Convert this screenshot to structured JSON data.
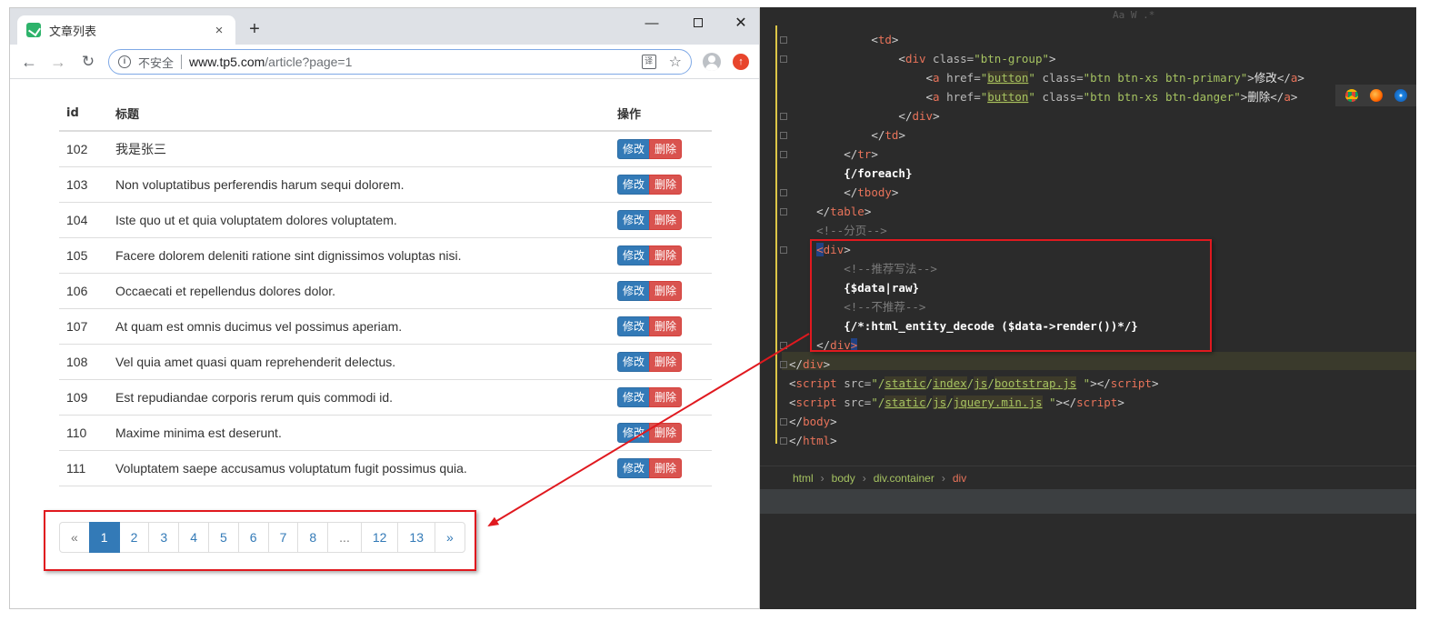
{
  "browser": {
    "tab_title": "文章列表",
    "tab_close": "×",
    "new_tab": "+",
    "window_min": "—",
    "window_close": "✕",
    "nav_back": "←",
    "nav_forward": "→",
    "nav_reload": "↻",
    "security_label": "不安全",
    "url_host": "www.tp5.com",
    "url_path": "/article?page=1",
    "translate_glyph": "译",
    "star_glyph": "☆",
    "update_glyph": "↑"
  },
  "table": {
    "headers": {
      "id": "id",
      "title": "标题",
      "ops": "操作"
    },
    "edit_label": "修改",
    "delete_label": "删除",
    "rows": [
      {
        "id": "102",
        "title": "我是张三"
      },
      {
        "id": "103",
        "title": "Non voluptatibus perferendis harum sequi dolorem."
      },
      {
        "id": "104",
        "title": "Iste quo ut et quia voluptatem dolores voluptatem."
      },
      {
        "id": "105",
        "title": "Facere dolorem deleniti ratione sint dignissimos voluptas nisi."
      },
      {
        "id": "106",
        "title": "Occaecati et repellendus dolores dolor."
      },
      {
        "id": "107",
        "title": "At quam est omnis ducimus vel possimus aperiam."
      },
      {
        "id": "108",
        "title": "Vel quia amet quasi quam reprehenderit delectus."
      },
      {
        "id": "109",
        "title": "Est repudiandae corporis rerum quis commodi id."
      },
      {
        "id": "110",
        "title": "Maxime minima est deserunt."
      },
      {
        "id": "111",
        "title": "Voluptatem saepe accusamus voluptatum fugit possimus quia."
      }
    ]
  },
  "pagination": {
    "prev": "«",
    "pages": [
      "1",
      "2",
      "3",
      "4",
      "5",
      "6",
      "7",
      "8",
      "...",
      "12",
      "13"
    ],
    "next": "»",
    "active": "1"
  },
  "ide": {
    "toolbar_hint": "Aa  W  .*",
    "code_lines": [
      {
        "parts": [
          [
            "i",
            "            "
          ],
          [
            "p",
            "<"
          ],
          [
            "t",
            "td"
          ],
          [
            "p",
            ">"
          ]
        ]
      },
      {
        "parts": [
          [
            "i",
            "                "
          ],
          [
            "p",
            "<"
          ],
          [
            "t",
            "div"
          ],
          [
            "a",
            " class="
          ],
          [
            "v",
            "\"btn-group\""
          ],
          [
            "p",
            ">"
          ]
        ]
      },
      {
        "parts": [
          [
            "i",
            "                    "
          ],
          [
            "p",
            "<"
          ],
          [
            "t",
            "a"
          ],
          [
            "a",
            " href="
          ],
          [
            "v",
            "\""
          ],
          [
            "l",
            "button"
          ],
          [
            "v",
            "\""
          ],
          [
            "a",
            " class="
          ],
          [
            "v",
            "\"btn btn-xs btn-primary\""
          ],
          [
            "p",
            ">"
          ],
          [
            "x",
            "修改"
          ],
          [
            "p",
            "</"
          ],
          [
            "t",
            "a"
          ],
          [
            "p",
            ">"
          ]
        ]
      },
      {
        "parts": [
          [
            "i",
            "                    "
          ],
          [
            "p",
            "<"
          ],
          [
            "t",
            "a"
          ],
          [
            "a",
            " href="
          ],
          [
            "v",
            "\""
          ],
          [
            "l",
            "button"
          ],
          [
            "v",
            "\""
          ],
          [
            "a",
            " class="
          ],
          [
            "v",
            "\"btn btn-xs btn-danger\""
          ],
          [
            "p",
            ">"
          ],
          [
            "x",
            "删除"
          ],
          [
            "p",
            "</"
          ],
          [
            "t",
            "a"
          ],
          [
            "p",
            ">"
          ]
        ]
      },
      {
        "parts": [
          [
            "i",
            "                "
          ],
          [
            "p",
            "</"
          ],
          [
            "t",
            "div"
          ],
          [
            "p",
            ">"
          ]
        ]
      },
      {
        "parts": [
          [
            "i",
            "            "
          ],
          [
            "p",
            "</"
          ],
          [
            "t",
            "td"
          ],
          [
            "p",
            ">"
          ]
        ]
      },
      {
        "parts": [
          [
            "i",
            "        "
          ],
          [
            "p",
            "</"
          ],
          [
            "t",
            "tr"
          ],
          [
            "p",
            ">"
          ]
        ]
      },
      {
        "parts": [
          [
            "i",
            "        "
          ],
          [
            "b",
            "{/foreach}"
          ]
        ]
      },
      {
        "parts": [
          [
            "i",
            "        "
          ],
          [
            "p",
            "</"
          ],
          [
            "t",
            "tbody"
          ],
          [
            "p",
            ">"
          ]
        ]
      },
      {
        "parts": [
          [
            "i",
            "    "
          ],
          [
            "p",
            "</"
          ],
          [
            "t",
            "table"
          ],
          [
            "p",
            ">"
          ]
        ]
      },
      {
        "parts": [
          [
            "i",
            "    "
          ],
          [
            "c",
            "<!--分页-->"
          ]
        ]
      },
      {
        "parts": [
          [
            "i",
            "    "
          ],
          [
            "k",
            "<"
          ],
          [
            "t",
            "div"
          ],
          [
            "p",
            ">"
          ]
        ]
      },
      {
        "parts": [
          [
            "i",
            "        "
          ],
          [
            "c",
            "<!--推荐写法-->"
          ]
        ]
      },
      {
        "parts": [
          [
            "i",
            "        "
          ],
          [
            "b",
            "{$data|raw}"
          ]
        ]
      },
      {
        "parts": [
          [
            "i",
            "        "
          ],
          [
            "c",
            "<!--不推荐-->"
          ]
        ]
      },
      {
        "parts": [
          [
            "i",
            "        "
          ],
          [
            "b",
            "{/*:html_entity_decode ($data->render())*/}"
          ]
        ]
      },
      {
        "parts": [
          [
            "i",
            "    "
          ],
          [
            "p",
            "</"
          ],
          [
            "t",
            "div"
          ],
          [
            "k",
            ">"
          ]
        ]
      },
      {
        "parts": [
          [
            "p",
            "</"
          ],
          [
            "t",
            "div"
          ],
          [
            "p",
            ">"
          ]
        ]
      },
      {
        "parts": [
          [
            "p",
            "<"
          ],
          [
            "t",
            "script"
          ],
          [
            "a",
            " src="
          ],
          [
            "v",
            "\"/"
          ],
          [
            "l",
            "static"
          ],
          [
            "v",
            "/"
          ],
          [
            "l",
            "index"
          ],
          [
            "v",
            "/"
          ],
          [
            "l",
            "js"
          ],
          [
            "v",
            "/"
          ],
          [
            "l",
            "bootstrap.js"
          ],
          [
            "v",
            " \""
          ],
          [
            "p",
            "></"
          ],
          [
            "t",
            "script"
          ],
          [
            "p",
            ">"
          ]
        ]
      },
      {
        "parts": [
          [
            "p",
            "<"
          ],
          [
            "t",
            "script"
          ],
          [
            "a",
            " src="
          ],
          [
            "v",
            "\"/"
          ],
          [
            "l",
            "static"
          ],
          [
            "v",
            "/"
          ],
          [
            "l",
            "js"
          ],
          [
            "v",
            "/"
          ],
          [
            "l",
            "jquery.min.js"
          ],
          [
            "v",
            " \""
          ],
          [
            "p",
            "></"
          ],
          [
            "t",
            "script"
          ],
          [
            "p",
            ">"
          ]
        ]
      },
      {
        "parts": [
          [
            "p",
            "</"
          ],
          [
            "t",
            "body"
          ],
          [
            "p",
            ">"
          ]
        ]
      },
      {
        "parts": [
          [
            "p",
            "</"
          ],
          [
            "t",
            "html"
          ],
          [
            "p",
            ">"
          ]
        ]
      }
    ],
    "breadcrumb": [
      "html",
      "body",
      "div.container",
      "div"
    ],
    "breadcrumb_sep": "›",
    "icons": [
      "chrome-icon",
      "firefox-icon",
      "safari-icon"
    ]
  },
  "colors": {
    "primary": "#337ab7",
    "danger": "#d9534f",
    "annotation_red": "#e0191f",
    "ide_bg": "#2b2b2b",
    "tag": "#e8735a",
    "string": "#a5c261"
  }
}
